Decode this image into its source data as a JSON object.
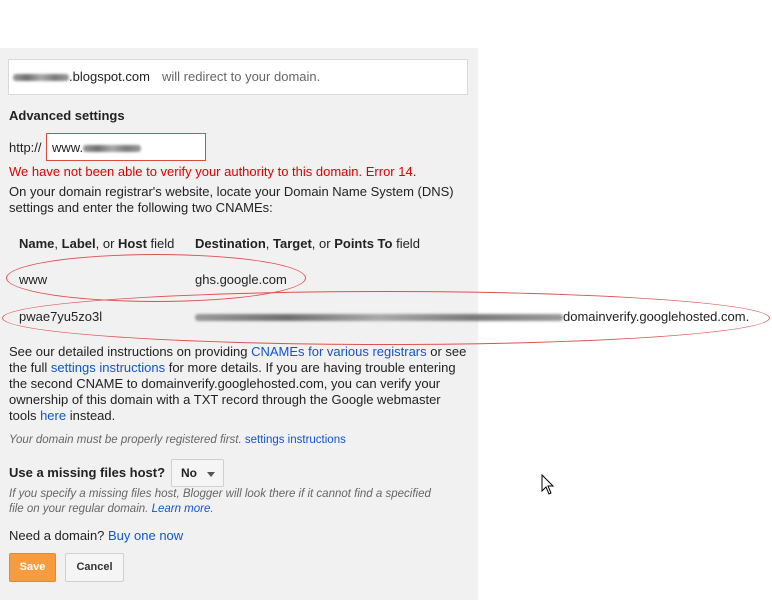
{
  "redirect": {
    "subdomain_suffix": ".blogspot.com",
    "message": "will redirect to your domain."
  },
  "advanced": {
    "heading": "Advanced settings",
    "http_prefix": "http://",
    "domain_value_prefix": "www.",
    "error": "We have not been able to verify your authority to this domain. Error 14.",
    "intro_line1": "On your domain registrar's website, locate your Domain Name System (DNS)",
    "intro_line2": "settings and enter the following two CNAMEs:"
  },
  "cname_table": {
    "col1": {
      "w1": "Name",
      "sep1": ", ",
      "w2": "Label",
      "sep2": ", or ",
      "w3": "Host",
      "tail": " field"
    },
    "col2": {
      "w1": "Destination",
      "sep1": ", ",
      "w2": "Target",
      "sep2": ", or ",
      "w3": "Points To",
      "tail": " field"
    },
    "rows": [
      {
        "name": "www",
        "destination": "ghs.google.com"
      },
      {
        "name": "pwae7yu5zo3l",
        "destination_suffix": "domainverify.googlehosted.com."
      }
    ]
  },
  "instructions": {
    "l1_pre": "See our detailed instructions on providing ",
    "l1_link": "CNAMEs for various registrars",
    "l1_post": " or see",
    "l2_pre": "the full ",
    "l2_link": "settings instructions",
    "l2_post": " for more details. If you are having trouble entering",
    "l3": "the second CNAME to domainverify.googlehosted.com, you can verify your",
    "l4": "ownership of this domain with a TXT record through the Google webmaster",
    "l5_pre": "tools ",
    "l5_link": "here",
    "l5_post": " instead."
  },
  "registered_note": {
    "text": "Your domain must be properly registered first. ",
    "link": "settings instructions"
  },
  "missing_files": {
    "label": "Use a missing files host?",
    "value": "No",
    "help_l1": "If you specify a missing files host, Blogger will look there if it cannot find a specified",
    "help_l2_pre": "file on your regular domain. ",
    "help_link": "Learn more",
    "help_l2_post": "."
  },
  "buy": {
    "text": "Need a domain? ",
    "link": "Buy one now"
  },
  "buttons": {
    "save": "Save",
    "cancel": "Cancel"
  },
  "colors": {
    "error": "#dd0000",
    "link": "#1155cc",
    "save": "#f79c3e",
    "annotation": "#e05050"
  },
  "icons": {
    "dropdown": "caret-down-icon",
    "cursor": "mouse-pointer-icon"
  }
}
